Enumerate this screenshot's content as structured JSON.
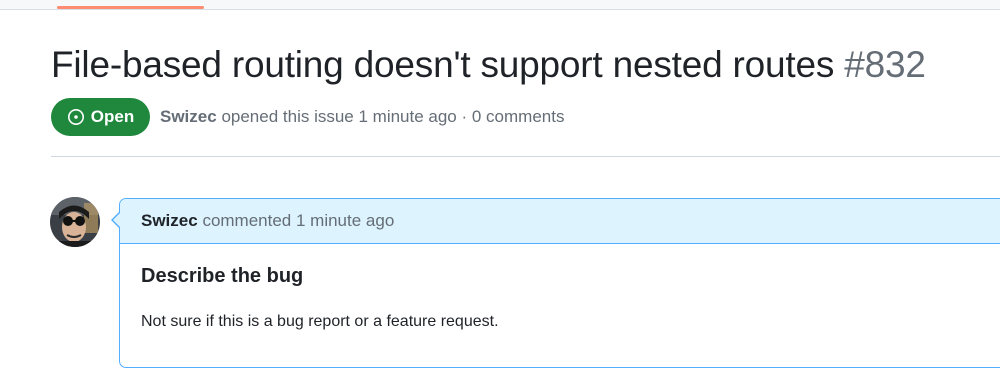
{
  "issue": {
    "title": "File-based routing doesn't support nested routes",
    "number": "#832",
    "state": "Open",
    "author": "Swizec",
    "meta_text": "opened this issue 1 minute ago · 0 comments"
  },
  "comment": {
    "author": "Swizec",
    "header_text": "commented 1 minute ago",
    "heading": "Describe the bug",
    "body": "Not sure if this is a bug report or a feature request."
  },
  "icons": {
    "state": "issue-opened-icon",
    "avatar": "user-avatar"
  },
  "colors": {
    "open_badge": "#1f883d",
    "tab_underline": "#fd8c73",
    "comment_header_bg": "#ddf4ff",
    "comment_border": "#54aeff"
  }
}
